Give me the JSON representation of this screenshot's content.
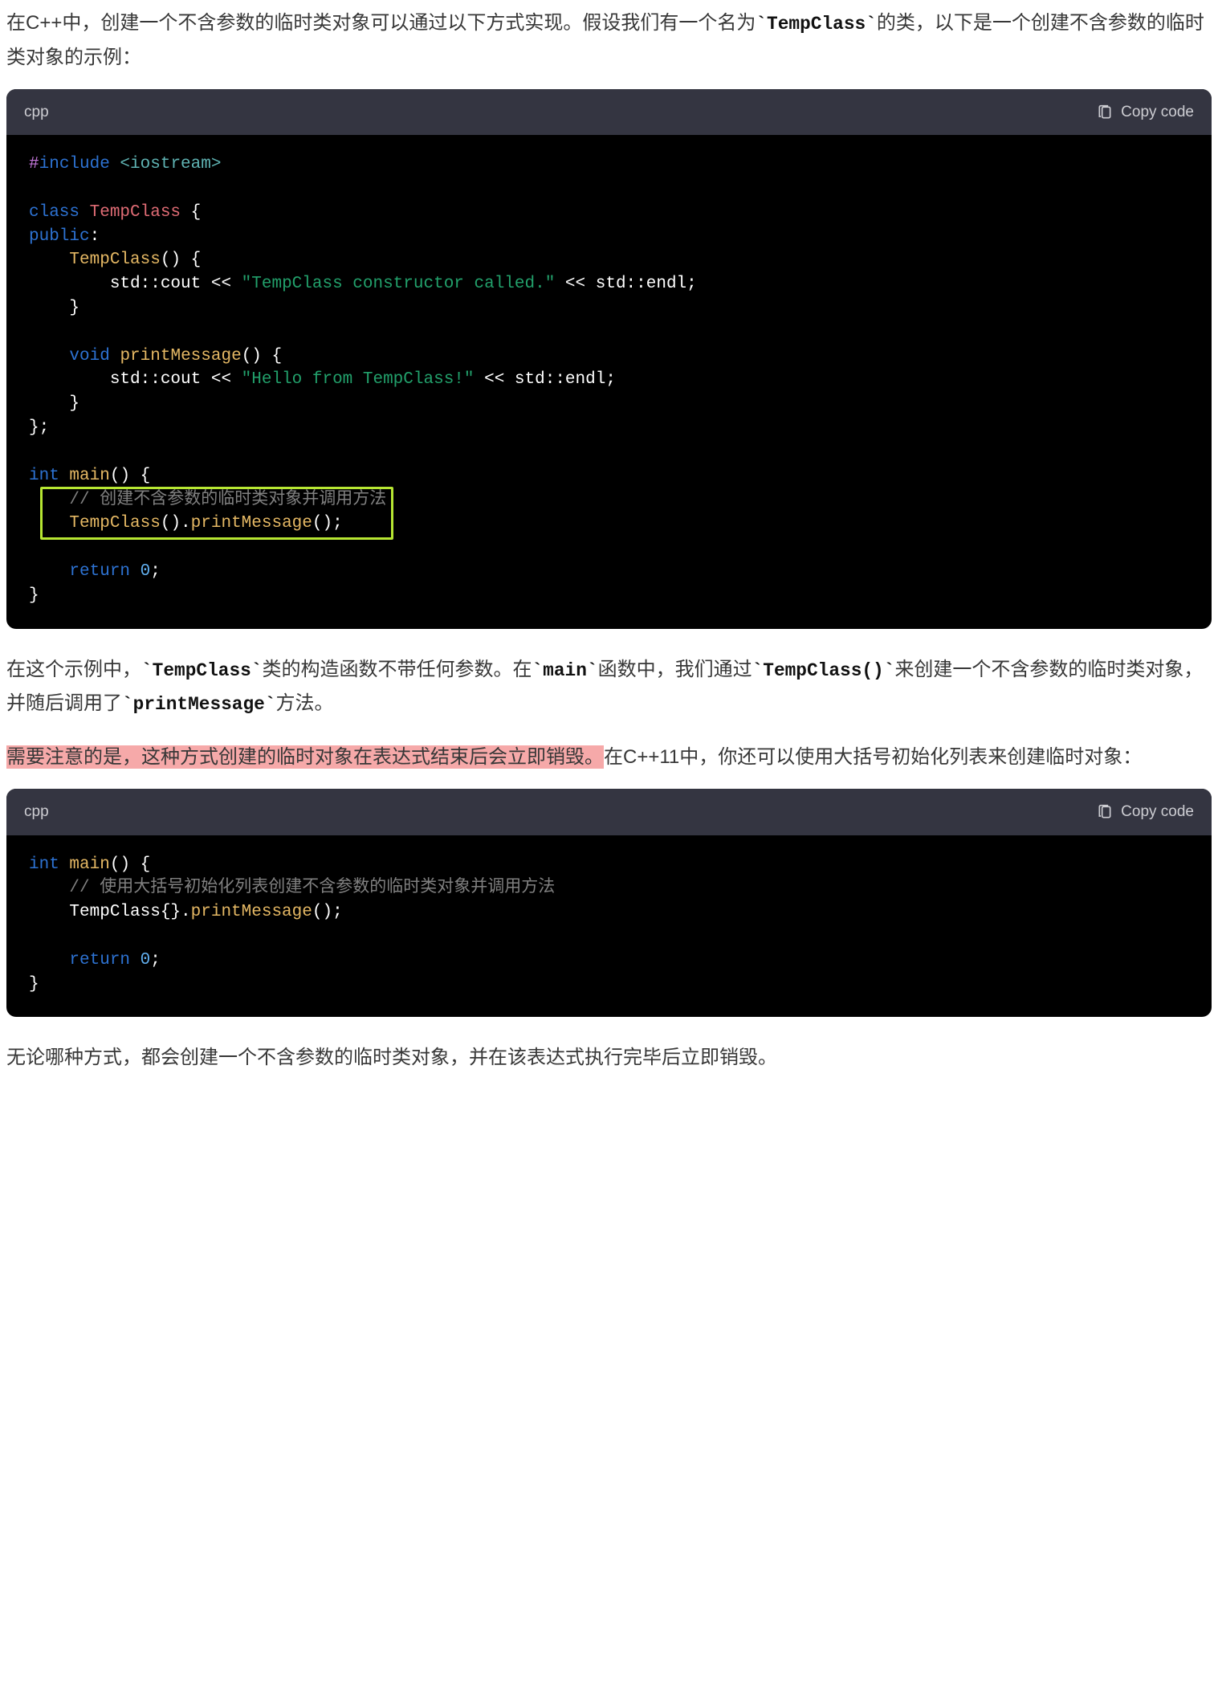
{
  "para1": {
    "t1": "在C++中，创建一个不含参数的临时类对象可以通过以下方式实现。假设我们有一个名为",
    "code1": "`TempClass`",
    "t2": "的类，以下是一个创建不含参数的临时类对象的示例："
  },
  "block1": {
    "lang": "cpp",
    "copy": "Copy code",
    "l1_a": "#",
    "l1_b": "include",
    "l1_c": " <iostream>",
    "l3_a": "class",
    "l3_b": " TempClass",
    "l3_c": " {",
    "l4_a": "public",
    "l4_b": ":",
    "l5_a": "    ",
    "l5_b": "TempClass",
    "l5_c": "() {",
    "l6_a": "        std::cout << ",
    "l6_b": "\"TempClass constructor called.\"",
    "l6_c": " << std::endl;",
    "l7": "    }",
    "l9_a": "    ",
    "l9_b": "void",
    "l9_c": " ",
    "l9_d": "printMessage",
    "l9_e": "() {",
    "l10_a": "        std::cout << ",
    "l10_b": "\"Hello from TempClass!\"",
    "l10_c": " << std::endl;",
    "l11": "    }",
    "l12": "};",
    "l14_a": "int",
    "l14_b": " ",
    "l14_c": "main",
    "l14_d": "() {",
    "l15_a": "    ",
    "l15_b": "// 创建不含参数的临时类对象并调用方法",
    "l16_a": "    ",
    "l16_b": "TempClass",
    "l16_c": "().",
    "l16_d": "printMessage",
    "l16_e": "();",
    "l18_a": "    ",
    "l18_b": "return",
    "l18_c": " ",
    "l18_d": "0",
    "l18_e": ";",
    "l19": "}"
  },
  "para2": {
    "t1": "在这个示例中，",
    "code1": "`TempClass`",
    "t2": "类的构造函数不带任何参数。在",
    "code2": "`main`",
    "t3": "函数中，我们通过",
    "code3": "`TempClass()`",
    "t4": "来创建一个不含参数的临时类对象，并随后调用了",
    "code4": "`printMessage`",
    "t5": "方法。"
  },
  "para3": {
    "hl": "需要注意的是，这种方式创建的临时对象在表达式结束后会立即销毁。",
    "rest": "在C++11中，你还可以使用大括号初始化列表来创建临时对象："
  },
  "block2": {
    "lang": "cpp",
    "copy": "Copy code",
    "l1_a": "int",
    "l1_b": " ",
    "l1_c": "main",
    "l1_d": "() {",
    "l2_a": "    ",
    "l2_b": "// 使用大括号初始化列表创建不含参数的临时类对象并调用方法",
    "l3_a": "    TempClass{}.",
    "l3_b": "printMessage",
    "l3_c": "();",
    "l5_a": "    ",
    "l5_b": "return",
    "l5_c": " ",
    "l5_d": "0",
    "l5_e": ";",
    "l6": "}"
  },
  "para4": "无论哪种方式，都会创建一个不含参数的临时类对象，并在该表达式执行完毕后立即销毁。"
}
